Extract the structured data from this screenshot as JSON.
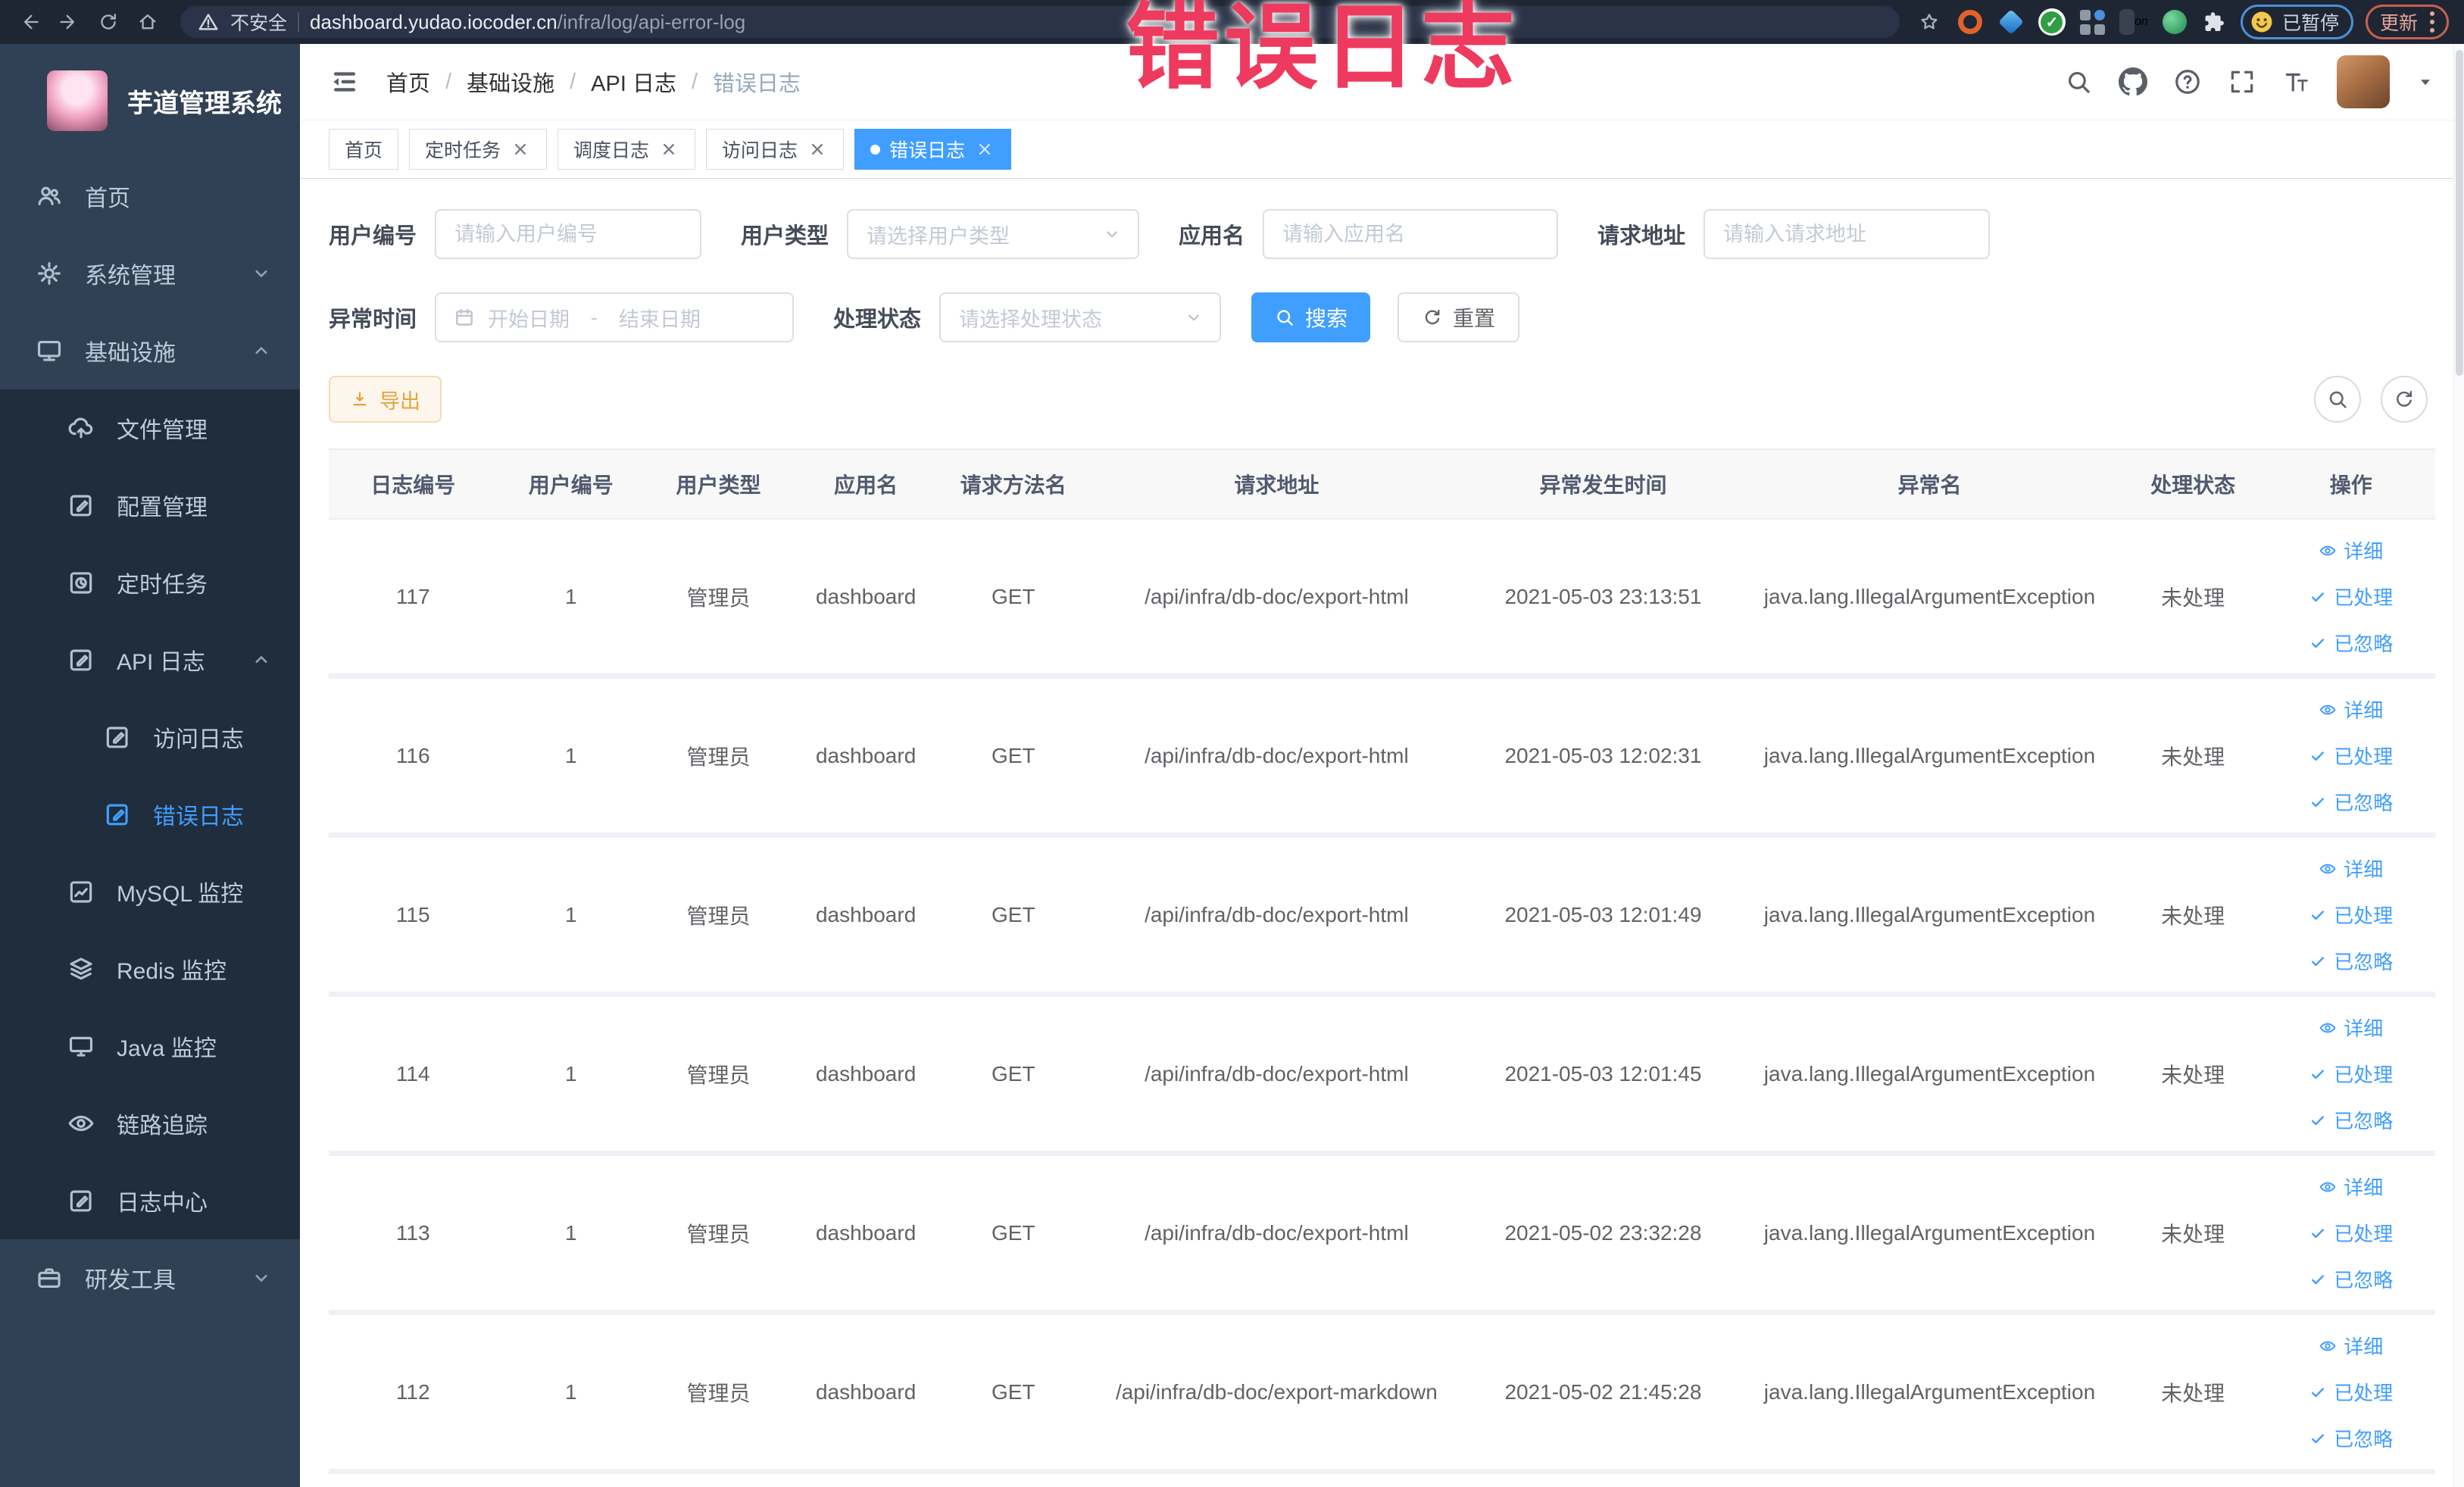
{
  "browser": {
    "security_label": "不安全",
    "url_domain": "dashboard.yudao.iocoder.cn",
    "url_path": "/infra/log/api-error-log",
    "profile_chip_label": "已暂停",
    "update_button_label": "更新",
    "toolbar_icons": [
      "back",
      "forward",
      "reload",
      "home"
    ],
    "extension_icons": [
      "bookmark-star",
      "orange-ring",
      "blue-diamond",
      "green-check",
      "grid-apps",
      "on-badge",
      "leaf",
      "puzzle"
    ]
  },
  "annotation": {
    "text": "错误日志",
    "color": "#ee3a5e"
  },
  "sidebar": {
    "title": "芋道管理系统",
    "items": [
      {
        "label": "首页",
        "icon": "peoples",
        "depth": 0
      },
      {
        "label": "系统管理",
        "icon": "gear",
        "depth": 0,
        "chevron": "down"
      },
      {
        "label": "基础设施",
        "icon": "monitor",
        "depth": 0,
        "chevron": "up"
      },
      {
        "label": "文件管理",
        "icon": "cloud-upload",
        "depth": 1
      },
      {
        "label": "配置管理",
        "icon": "edit-square",
        "depth": 1
      },
      {
        "label": "定时任务",
        "icon": "timer",
        "depth": 1
      },
      {
        "label": "API 日志",
        "icon": "edit-square",
        "depth": 1,
        "chevron": "up"
      },
      {
        "label": "访问日志",
        "icon": "edit-square",
        "depth": 2
      },
      {
        "label": "错误日志",
        "icon": "edit-square",
        "depth": 2,
        "active": true
      },
      {
        "label": "MySQL 监控",
        "icon": "chart",
        "depth": 1
      },
      {
        "label": "Redis 监控",
        "icon": "layers",
        "depth": 1
      },
      {
        "label": "Java 监控",
        "icon": "desktop",
        "depth": 1
      },
      {
        "label": "链路追踪",
        "icon": "eye",
        "depth": 1
      },
      {
        "label": "日志中心",
        "icon": "edit-square",
        "depth": 1
      },
      {
        "label": "研发工具",
        "icon": "suitcase",
        "depth": 0,
        "chevron": "down"
      }
    ]
  },
  "header": {
    "breadcrumb": [
      "首页",
      "基础设施",
      "API 日志",
      "错误日志"
    ],
    "right_icons": [
      "search",
      "github",
      "question",
      "fullscreen",
      "font-size"
    ]
  },
  "tabs": [
    {
      "label": "首页",
      "closable": false,
      "active": false
    },
    {
      "label": "定时任务",
      "closable": true,
      "active": false
    },
    {
      "label": "调度日志",
      "closable": true,
      "active": false
    },
    {
      "label": "访问日志",
      "closable": true,
      "active": false
    },
    {
      "label": "错误日志",
      "closable": true,
      "active": true
    }
  ],
  "filters": {
    "user_id": {
      "label": "用户编号",
      "placeholder": "请输入用户编号"
    },
    "user_type": {
      "label": "用户类型",
      "placeholder": "请选择用户类型"
    },
    "app_name": {
      "label": "应用名",
      "placeholder": "请输入应用名"
    },
    "request_url": {
      "label": "请求地址",
      "placeholder": "请输入请求地址"
    },
    "exception_time": {
      "label": "异常时间",
      "start_placeholder": "开始日期",
      "separator": "-",
      "end_placeholder": "结束日期"
    },
    "process_status": {
      "label": "处理状态",
      "placeholder": "请选择处理状态"
    },
    "search_button": "搜索",
    "reset_button": "重置"
  },
  "toolbar": {
    "export_button": "导出"
  },
  "table": {
    "columns": [
      "日志编号",
      "用户编号",
      "用户类型",
      "应用名",
      "请求方法名",
      "请求地址",
      "异常发生时间",
      "异常名",
      "处理状态",
      "操作"
    ],
    "actions": [
      "详细",
      "已处理",
      "已忽略"
    ],
    "rows": [
      {
        "id": "117",
        "user_id": "1",
        "user_type": "管理员",
        "app": "dashboard",
        "method": "GET",
        "url": "/api/infra/db-doc/export-html",
        "time": "2021-05-03 23:13:51",
        "exception": "java.lang.IllegalArgumentException",
        "status": "未处理"
      },
      {
        "id": "116",
        "user_id": "1",
        "user_type": "管理员",
        "app": "dashboard",
        "method": "GET",
        "url": "/api/infra/db-doc/export-html",
        "time": "2021-05-03 12:02:31",
        "exception": "java.lang.IllegalArgumentException",
        "status": "未处理"
      },
      {
        "id": "115",
        "user_id": "1",
        "user_type": "管理员",
        "app": "dashboard",
        "method": "GET",
        "url": "/api/infra/db-doc/export-html",
        "time": "2021-05-03 12:01:49",
        "exception": "java.lang.IllegalArgumentException",
        "status": "未处理"
      },
      {
        "id": "114",
        "user_id": "1",
        "user_type": "管理员",
        "app": "dashboard",
        "method": "GET",
        "url": "/api/infra/db-doc/export-html",
        "time": "2021-05-03 12:01:45",
        "exception": "java.lang.IllegalArgumentException",
        "status": "未处理"
      },
      {
        "id": "113",
        "user_id": "1",
        "user_type": "管理员",
        "app": "dashboard",
        "method": "GET",
        "url": "/api/infra/db-doc/export-html",
        "time": "2021-05-02 23:32:28",
        "exception": "java.lang.IllegalArgumentException",
        "status": "未处理"
      },
      {
        "id": "112",
        "user_id": "1",
        "user_type": "管理员",
        "app": "dashboard",
        "method": "GET",
        "url": "/api/infra/db-doc/export-markdown",
        "time": "2021-05-02 21:45:28",
        "exception": "java.lang.IllegalArgumentException",
        "status": "未处理"
      }
    ]
  },
  "colors": {
    "accent_blue": "#409eff",
    "sidebar_bg": "#304156",
    "submenu_bg": "#1f2d3d",
    "warning": "#e6a23c",
    "annotation_red": "#ee3a5e"
  }
}
